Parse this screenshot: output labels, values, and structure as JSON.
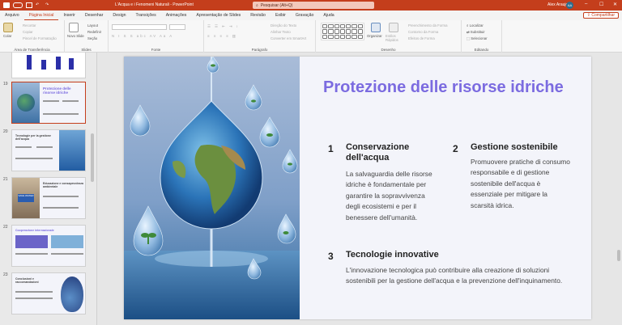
{
  "window": {
    "doc_title": "L'Acqua e i Fenomeni Naturali  -  PowerPoint",
    "search_placeholder": "Pesquisar (Alt+Q)",
    "user_name": "Alex Araujo",
    "user_initials": "AA",
    "share_label": "Compartilhar"
  },
  "menu": {
    "tabs": [
      "Arquivo",
      "Página Inicial",
      "Inserir",
      "Desenhar",
      "Design",
      "Transições",
      "Animações",
      "Apresentação de Slides",
      "Revisão",
      "Exibir",
      "Gravação",
      "Ajuda"
    ],
    "active": 1
  },
  "ribbon": {
    "clipboard": {
      "label": "Área de Transferência",
      "paste": "Colar",
      "cut": "Recortar",
      "copy": "Copiar",
      "format_painter": "Pincel de Formatação"
    },
    "slides": {
      "label": "Slides",
      "new_slide": "Novo Slide",
      "layout": "Layout",
      "reset": "Redefinir",
      "section": "Seção"
    },
    "font": {
      "label": "Fonte"
    },
    "paragraph": {
      "label": "Parágrafo",
      "text_direction": "Direção do Texto",
      "align_text": "Alinhar Texto",
      "smartart": "Converter em SmartArt"
    },
    "drawing": {
      "label": "Desenho",
      "arrange": "Organizar",
      "quick_styles": "Estilos Rápidos",
      "shape_fill": "Preenchimento da Forma",
      "shape_outline": "Contorno da Forma",
      "shape_effects": "Efeitos de Forma"
    },
    "editing": {
      "label": "Editando",
      "find": "Localizar",
      "replace": "Substituir",
      "select": "Selecionar"
    }
  },
  "thumbnails": {
    "numbers": [
      "19",
      "20",
      "21",
      "22",
      "23"
    ],
    "t19_title": "Protezione delle risorse idriche",
    "t20_title": "Tecnologie per la gestione dell'acqua",
    "t21_title": "Educazione e consapevolezza ambientale",
    "t21_badge": "SAVE WATER",
    "t22_title": "Cooperazione internazionale",
    "t23_title": "Conclusioni e raccomandazioni"
  },
  "slide": {
    "title": "Protezione delle risorse idriche",
    "items": [
      {
        "num": "1",
        "title": "Conservazione dell'acqua",
        "body": "La salvaguardia delle risorse idriche è fondamentale per garantire la sopravvivenza degli ecosistemi e per il benessere dell'umanità."
      },
      {
        "num": "2",
        "title": "Gestione sostenibile",
        "body": "Promuovere pratiche di consumo responsabile e di gestione sostenibile dell'acqua è essenziale per mitigare la scarsità idrica."
      },
      {
        "num": "3",
        "title": "Tecnologie innovative",
        "body": "L'innovazione tecnologica può contribuire alla creazione di soluzioni sostenibili per la gestione dell'acqua e la prevenzione dell'inquinamento."
      }
    ]
  },
  "colors": {
    "accent": "#c43e1c",
    "title": "#7b6be0"
  }
}
